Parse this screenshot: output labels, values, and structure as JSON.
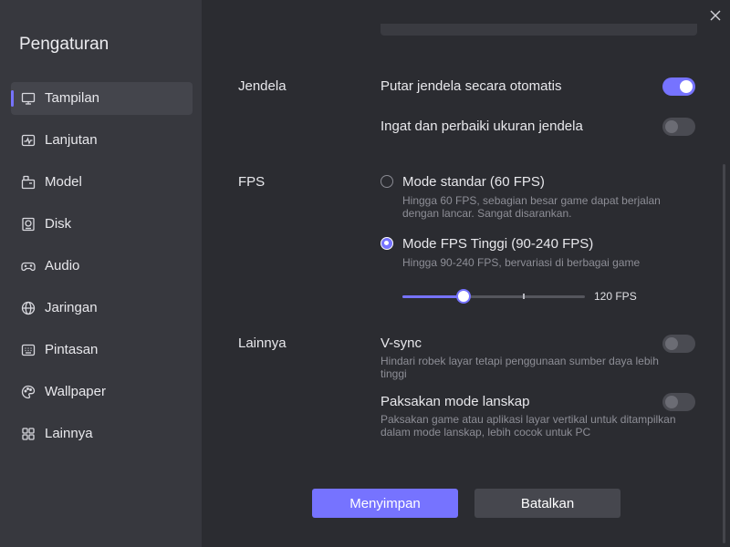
{
  "sidebar": {
    "title": "Pengaturan",
    "items": [
      {
        "label": "Tampilan",
        "icon": "monitor-icon",
        "active": true
      },
      {
        "label": "Lanjutan",
        "icon": "activity-icon"
      },
      {
        "label": "Model",
        "icon": "device-icon"
      },
      {
        "label": "Disk",
        "icon": "disk-icon"
      },
      {
        "label": "Audio",
        "icon": "gamepad-icon"
      },
      {
        "label": "Jaringan",
        "icon": "globe-icon"
      },
      {
        "label": "Pintasan",
        "icon": "keyboard-icon"
      },
      {
        "label": "Wallpaper",
        "icon": "palette-icon"
      },
      {
        "label": "Lainnya",
        "icon": "grid-icon"
      }
    ]
  },
  "sections": {
    "window": {
      "label": "Jendela",
      "auto_rotate": {
        "title": "Putar jendela secara otomatis",
        "enabled": true
      },
      "remember_size": {
        "title": "Ingat dan perbaiki ukuran jendela",
        "enabled": false
      }
    },
    "fps": {
      "label": "FPS",
      "standard": {
        "title": "Mode standar (60 FPS)",
        "desc": "Hingga 60 FPS, sebagian besar game dapat berjalan dengan lancar. Sangat disarankan.",
        "selected": false
      },
      "high": {
        "title": "Mode FPS Tinggi (90-240 FPS)",
        "desc": "Hingga 90-240 FPS, bervariasi di berbagai game",
        "selected": true
      },
      "slider": {
        "min": 90,
        "max": 240,
        "value": 120,
        "steps": [
          90,
          120,
          165,
          240
        ],
        "value_label": "120 FPS"
      }
    },
    "other": {
      "label": "Lainnya",
      "vsync": {
        "title": "V-sync",
        "desc": "Hindari robek layar tetapi penggunaan sumber daya lebih tinggi",
        "enabled": false
      },
      "landscape": {
        "title": "Paksakan mode lanskap",
        "desc": "Paksakan game atau aplikasi layar vertikal untuk ditampilkan dalam mode lanskap, lebih cocok untuk PC",
        "enabled": false
      }
    }
  },
  "buttons": {
    "save": "Menyimpan",
    "cancel": "Batalkan"
  },
  "colors": {
    "accent": "#7673ff",
    "sidebar_bg": "#37383e",
    "main_bg": "#2b2c31"
  }
}
